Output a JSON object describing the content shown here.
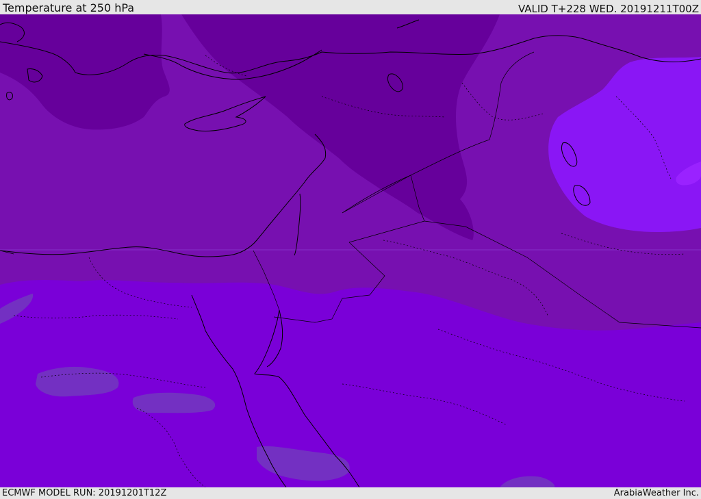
{
  "header": {
    "title": "Temperature at 250 hPa",
    "valid": "VALID T+228 WED. 20191211T00Z"
  },
  "footer": {
    "model_run": "ECMWF MODEL RUN: 20191201T12Z",
    "credit": "ArabiaWeather Inc."
  },
  "map": {
    "variable": "temperature",
    "level_hpa": 250,
    "colors": {
      "darkest": "#66009b",
      "dark": "#7710b0",
      "medium": "#7a00d8",
      "bright": "#8a16f5",
      "warm_patch": "#7330c2",
      "coast": "#000000"
    }
  }
}
